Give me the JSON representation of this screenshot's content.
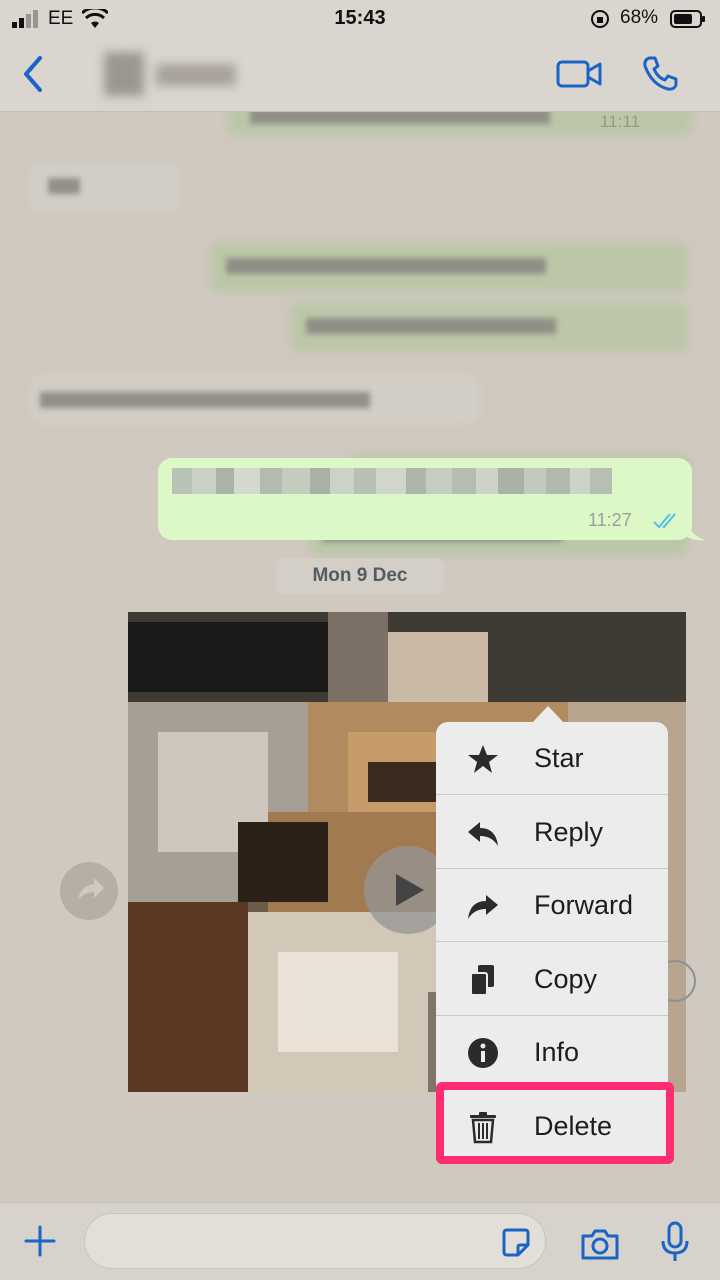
{
  "status_bar": {
    "carrier": "EE",
    "time": "15:43",
    "battery_percent": "68%",
    "signal_icon": "signal-bars-icon",
    "wifi_icon": "wifi-icon",
    "battery_icon": "battery-icon"
  },
  "header": {
    "back_icon": "chevron-left-icon",
    "video_icon": "video-camera-icon",
    "call_icon": "phone-icon",
    "accent": "#1a64c8"
  },
  "chat": {
    "earlier_time": "11:11",
    "focused_message": {
      "time": "11:27",
      "read_ticks_icon": "double-check-icon",
      "bubble_color": "#dcf8c6"
    },
    "date_chip": "Mon 9 Dec",
    "media": {
      "play_icon": "play-icon",
      "forward_icon": "share-icon"
    }
  },
  "context_menu": {
    "items": [
      {
        "label": "Star",
        "icon": "star-icon"
      },
      {
        "label": "Reply",
        "icon": "reply-icon"
      },
      {
        "label": "Forward",
        "icon": "forward-icon"
      },
      {
        "label": "Copy",
        "icon": "copy-icon"
      },
      {
        "label": "Info",
        "icon": "info-icon"
      },
      {
        "label": "Delete",
        "icon": "trash-icon"
      }
    ],
    "highlight_color": "#ff2d6f"
  },
  "composer": {
    "plus_icon": "plus-icon",
    "sticker_icon": "sticker-icon",
    "camera_icon": "camera-icon",
    "mic_icon": "microphone-icon"
  }
}
